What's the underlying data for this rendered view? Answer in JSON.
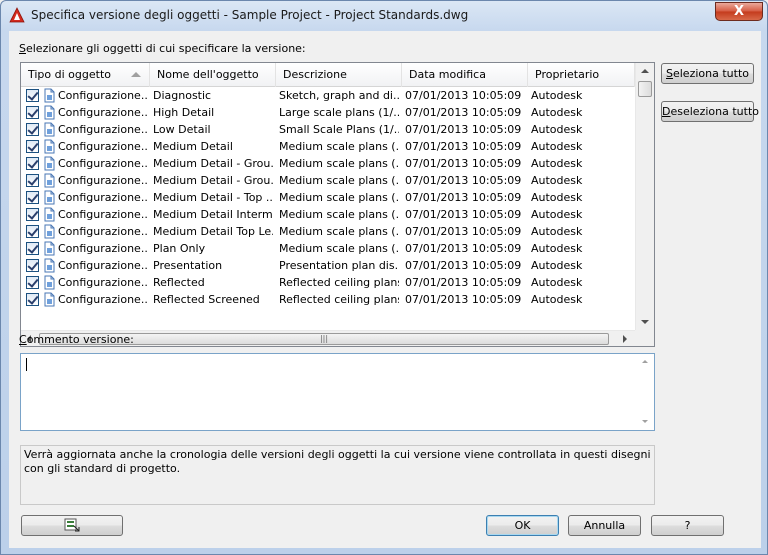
{
  "window": {
    "title": "Specifica versione degli oggetti - Sample Project - Project Standards.dwg",
    "close_glyph": "X"
  },
  "labels": {
    "select_objects_prefix": "S",
    "select_objects_rest": "elezionare gli oggetti di cui specificare la versione:",
    "comment_prefix": "C",
    "comment_rest": "ommento versione:"
  },
  "table": {
    "columns": [
      "Tipo di oggetto",
      "Nome dell'oggetto",
      "Descrizione",
      "Data modifica",
      "Proprietario"
    ],
    "sorted_column": "Tipo di oggetto",
    "rows": [
      {
        "type": "Configurazione...",
        "name": "Diagnostic",
        "desc": "Sketch, graph and di...",
        "date": "07/01/2013 10:05:09",
        "owner": "Autodesk",
        "checked": true
      },
      {
        "type": "Configurazione...",
        "name": "High Detail",
        "desc": "Large scale plans (1/...",
        "date": "07/01/2013 10:05:09",
        "owner": "Autodesk",
        "checked": true
      },
      {
        "type": "Configurazione...",
        "name": "Low Detail",
        "desc": "Small Scale Plans (1/...",
        "date": "07/01/2013 10:05:09",
        "owner": "Autodesk",
        "checked": true
      },
      {
        "type": "Configurazione...",
        "name": "Medium Detail",
        "desc": "Medium scale plans (...",
        "date": "07/01/2013 10:05:09",
        "owner": "Autodesk",
        "checked": true
      },
      {
        "type": "Configurazione...",
        "name": "Medium Detail - Grou...",
        "desc": "Medium scale plans (...",
        "date": "07/01/2013 10:05:09",
        "owner": "Autodesk",
        "checked": true
      },
      {
        "type": "Configurazione...",
        "name": "Medium Detail - Grou...",
        "desc": "Medium scale plans (...",
        "date": "07/01/2013 10:05:09",
        "owner": "Autodesk",
        "checked": true
      },
      {
        "type": "Configurazione...",
        "name": "Medium Detail - Top ...",
        "desc": "Medium scale plans (...",
        "date": "07/01/2013 10:05:09",
        "owner": "Autodesk",
        "checked": true
      },
      {
        "type": "Configurazione...",
        "name": "Medium Detail Interm...",
        "desc": "Medium scale plans (...",
        "date": "07/01/2013 10:05:09",
        "owner": "Autodesk",
        "checked": true
      },
      {
        "type": "Configurazione...",
        "name": "Medium Detail Top Le...",
        "desc": "Medium scale plans (...",
        "date": "07/01/2013 10:05:09",
        "owner": "Autodesk",
        "checked": true
      },
      {
        "type": "Configurazione...",
        "name": "Plan Only",
        "desc": "Medium scale plans (...",
        "date": "07/01/2013 10:05:09",
        "owner": "Autodesk",
        "checked": true
      },
      {
        "type": "Configurazione...",
        "name": "Presentation",
        "desc": "Presentation plan dis...",
        "date": "07/01/2013 10:05:09",
        "owner": "Autodesk",
        "checked": true
      },
      {
        "type": "Configurazione...",
        "name": "Reflected",
        "desc": "Reflected ceiling plans",
        "date": "07/01/2013 10:05:09",
        "owner": "Autodesk",
        "checked": true
      },
      {
        "type": "Configurazione...",
        "name": "Reflected Screened",
        "desc": "Reflected ceiling plans",
        "date": "07/01/2013 10:05:09",
        "owner": "Autodesk",
        "checked": true
      }
    ]
  },
  "buttons": {
    "select_all_prefix": "S",
    "select_all_rest": "eleziona tutto",
    "deselect_all_prefix": "D",
    "deselect_all_rest": "eseleziona tutto",
    "ok": "OK",
    "cancel": "Annulla",
    "help": "?"
  },
  "comment": {
    "value": ""
  },
  "info": {
    "text": "Verrà aggiornata anche la cronologia delle versioni degli oggetti la cui versione viene controllata in questi disegni con gli standard di progetto."
  },
  "colors": {
    "title_gradient_top": "#dbe7f5",
    "close_red": "#c43a1c",
    "default_button_border": "#3c7fb1"
  }
}
